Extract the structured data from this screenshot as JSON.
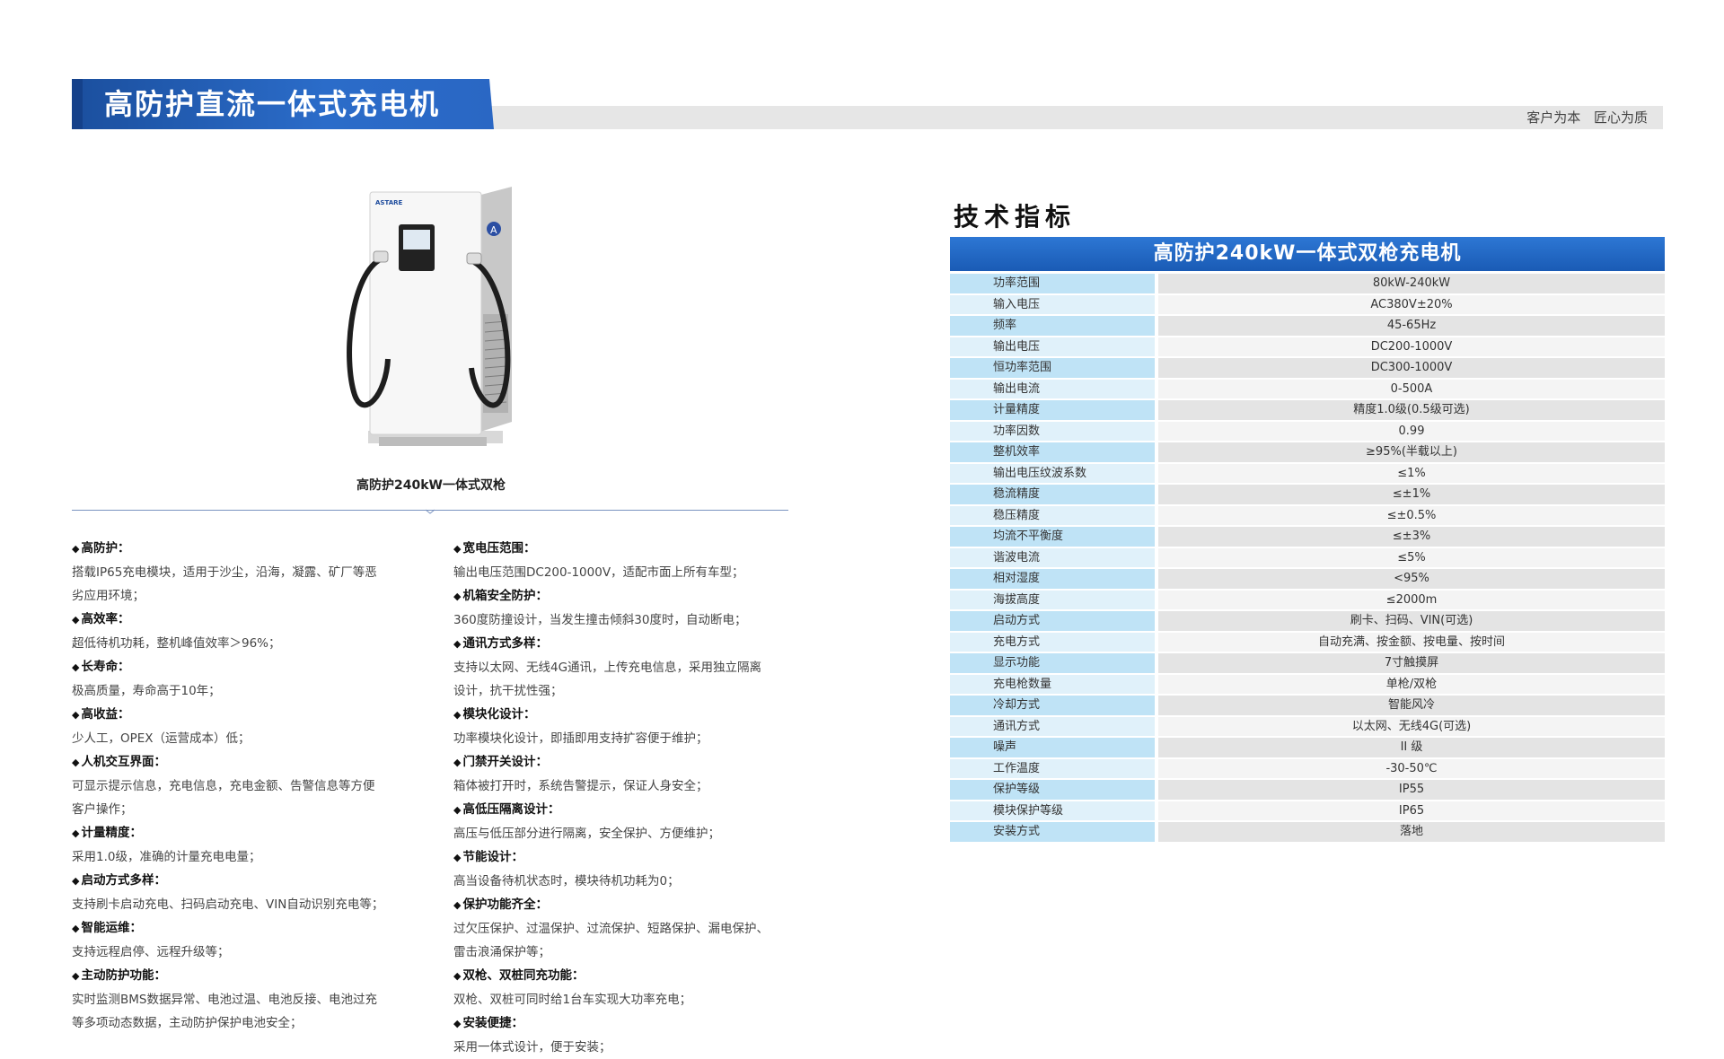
{
  "header": {
    "title": "高防护直流一体式充电机",
    "slogan": "客户为本  匠心为质"
  },
  "product": {
    "caption": "高防护240kW一体式双枪",
    "brand_text": "ASTARE"
  },
  "features_left": [
    {
      "title": "高防护：",
      "desc": [
        "搭载IP65充电模块，适用于沙尘，沿海，凝露、矿厂等恶",
        "劣应用环境；"
      ]
    },
    {
      "title": "高效率：",
      "desc": [
        "超低待机功耗，整机峰值效率＞96%；"
      ]
    },
    {
      "title": "长寿命：",
      "desc": [
        "极高质量，寿命高于10年；"
      ]
    },
    {
      "title": "高收益：",
      "desc": [
        "少人工，OPEX（运营成本）低；"
      ]
    },
    {
      "title": "人机交互界面：",
      "desc": [
        "可显示提示信息，充电信息，充电金额、告警信息等方便",
        "客户操作；"
      ]
    },
    {
      "title": "计量精度：",
      "desc": [
        "采用1.0级，准确的计量充电电量；"
      ]
    },
    {
      "title": "启动方式多样：",
      "desc": [
        "支持刷卡启动充电、扫码启动充电、VIN自动识别充电等；"
      ]
    },
    {
      "title": "智能运维：",
      "desc": [
        "支持远程启停、远程升级等；"
      ]
    },
    {
      "title": "主动防护功能：",
      "desc": [
        "实时监测BMS数据异常、电池过温、电池反接、电池过充",
        "等多项动态数据，主动防护保护电池安全；"
      ]
    }
  ],
  "features_right": [
    {
      "title": "宽电压范围：",
      "desc": [
        "输出电压范围DC200-1000V，适配市面上所有车型；"
      ]
    },
    {
      "title": "机箱安全防护：",
      "desc": [
        "360度防撞设计，当发生撞击倾斜30度时，自动断电；"
      ]
    },
    {
      "title": "通讯方式多样：",
      "desc": [
        "支持以太网、无线4G通讯，上传充电信息，采用独立隔离",
        "设计，抗干扰性强；"
      ]
    },
    {
      "title": "模块化设计：",
      "desc": [
        "功率模块化设计，即插即用支持扩容便于维护；"
      ]
    },
    {
      "title": "门禁开关设计：",
      "desc": [
        "箱体被打开时，系统告警提示，保证人身安全；"
      ]
    },
    {
      "title": "高低压隔离设计：",
      "desc": [
        "高压与低压部分进行隔离，安全保护、方便维护；"
      ]
    },
    {
      "title": "节能设计：",
      "desc": [
        "高当设备待机状态时，模块待机功耗为0；"
      ]
    },
    {
      "title": "保护功能齐全：",
      "desc": [
        "过欠压保护、过温保护、过流保护、短路保护、漏电保护、",
        "雷击浪涌保护等；"
      ]
    },
    {
      "title": "双枪、双桩同充功能：",
      "desc": [
        "双枪、双桩可同时给1台车实现大功率充电；"
      ]
    },
    {
      "title": "安装便捷：",
      "desc": [
        "采用一体式设计，便于安装；"
      ]
    }
  ],
  "spec": {
    "heading": "技术指标",
    "banner": "高防护240kW一体式双枪充电机",
    "rows": [
      [
        "功率范围",
        "80kW-240kW"
      ],
      [
        "输入电压",
        "AC380V±20%"
      ],
      [
        "频率",
        "45-65Hz"
      ],
      [
        "输出电压",
        "DC200-1000V"
      ],
      [
        "恒功率范围",
        "DC300-1000V"
      ],
      [
        "输出电流",
        "0-500A"
      ],
      [
        "计量精度",
        "精度1.0级(0.5级可选)"
      ],
      [
        "功率因数",
        "0.99"
      ],
      [
        "整机效率",
        "≥95%(半载以上)"
      ],
      [
        "输出电压纹波系数",
        "≤1%"
      ],
      [
        "稳流精度",
        "≤±1%"
      ],
      [
        "稳压精度",
        "≤±0.5%"
      ],
      [
        "均流不平衡度",
        "≤±3%"
      ],
      [
        "谐波电流",
        "≤5%"
      ],
      [
        "相对湿度",
        "<95%"
      ],
      [
        "海拔高度",
        "≤2000m"
      ],
      [
        "启动方式",
        "刷卡、扫码、VIN(可选)"
      ],
      [
        "充电方式",
        "自动充满、按金额、按电量、按时间"
      ],
      [
        "显示功能",
        "7寸触摸屏"
      ],
      [
        "充电枪数量",
        "单枪/双枪"
      ],
      [
        "冷却方式",
        "智能风冷"
      ],
      [
        "通讯方式",
        "以太网、无线4G(可选)"
      ],
      [
        "噪声",
        "II 级"
      ],
      [
        "工作温度",
        "-30-50℃"
      ],
      [
        "保护等级",
        "IP55"
      ],
      [
        "模块保护等级",
        "IP65"
      ],
      [
        "安装方式",
        "落地"
      ]
    ]
  }
}
